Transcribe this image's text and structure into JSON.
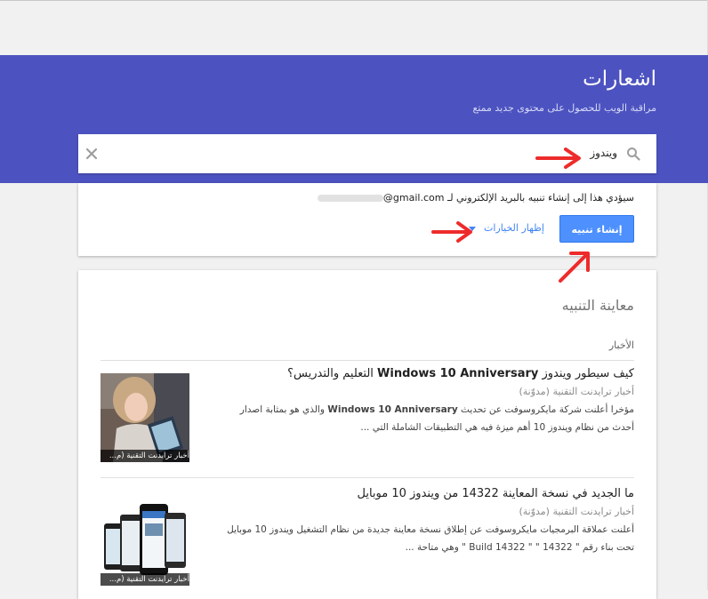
{
  "header": {
    "title": "اشعارات",
    "subtitle": "مراقبة الويب للحصول على محتوى جديد ممتع"
  },
  "search": {
    "value": "ويندوز"
  },
  "alert_options": {
    "notice_prefix": "سيؤدي هذا إلى إنشاء تنبيه بالبريد الإلكتروني لـ",
    "notice_email": "@gmail.com",
    "create_label": "إنشاء تنبيه",
    "show_options_label": "إظهار الخيارات"
  },
  "preview": {
    "title": "معاينة التنبيه",
    "section_label": "الأخبار",
    "articles": [
      {
        "title_pre": "كيف سيطور ويندوز ",
        "title_bold": "Windows 10 Anniversary",
        "title_post": " التعليم والتدريس؟",
        "source": "أخبار ترايدنت التقنية (مدوّنة)",
        "snippet_pre": "مؤخرا أعلنت شركة مايكروسوفت عن تحديث ",
        "snippet_bold": "Windows 10 Anniversary",
        "snippet_post": " والذي هو بمثابة اصدار أحدث من نظام ويندوز 10 أهم ميزة فيه هي التطبيقات الشاملة التي ...",
        "thumb_label": "أخبار ترايدنت التقنية (م..."
      },
      {
        "title_pre": "ما الجديد في نسخة المعاينة 14322 من ويندوز 10 موبايل",
        "title_bold": "",
        "title_post": "",
        "source": "أخبار ترايدنت التقنية (مدوّنة)",
        "snippet_pre": "أعلنت عملاقة البرمجيات مايكروسوفت عن إطلاق نسخة معاينة جديدة من نظام التشغيل ويندوز 10 موبايل تحت بناء رقم \" 14322 \" \" Build 14322 \" وهي متاحة ...",
        "snippet_bold": "",
        "snippet_post": "",
        "thumb_label": "أخبار ترايدنت التقنية (م..."
      }
    ]
  },
  "colors": {
    "header": "#4c53c0",
    "button": "#4d90fe",
    "link": "#4285f4",
    "annotation_arrow": "#ee2b2b"
  }
}
